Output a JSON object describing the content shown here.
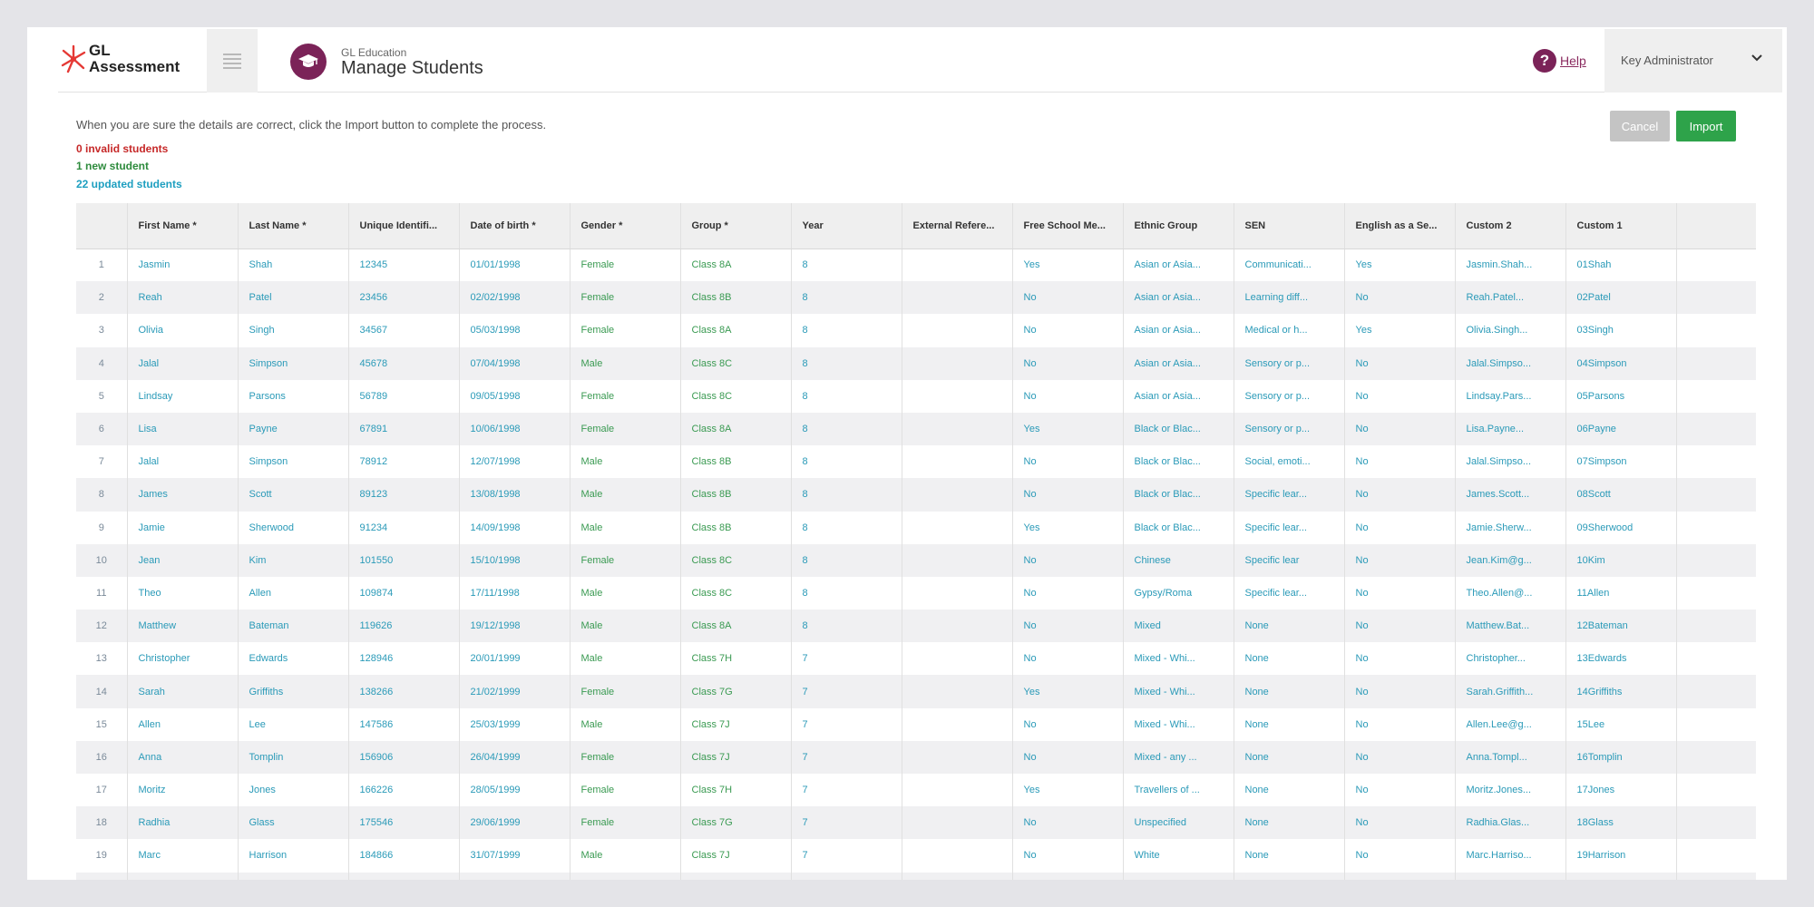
{
  "header": {
    "logo_text_line1": "GL",
    "logo_text_line2": "Assessment",
    "app_subtitle": "GL Education",
    "app_title": "Manage Students",
    "help_label": "Help",
    "user_name": "Key Administrator"
  },
  "instructions": "When you are sure the details are correct, click the Import button to complete the process.",
  "stats": {
    "invalid": "0 invalid students",
    "new": "1 new student",
    "updated": "22 updated students"
  },
  "buttons": {
    "cancel": "Cancel",
    "import": "Import"
  },
  "colors": {
    "brand": "#7b2358",
    "import_green": "#2ea34a",
    "invalid_red": "#c62828",
    "new_green": "#2e8b3d",
    "updated_blue": "#1e9fc0"
  },
  "table": {
    "columns": [
      "",
      "First Name *",
      "Last Name *",
      "Unique Identifi...",
      "Date of birth *",
      "Gender *",
      "Group *",
      "Year",
      "External Refere...",
      "Free School Me...",
      "Ethnic Group",
      "SEN",
      "English as a Se...",
      "Custom 2",
      "Custom 1",
      ""
    ],
    "rows": [
      [
        "1",
        "Jasmin",
        "Shah",
        "12345",
        "01/01/1998",
        "Female",
        "Class 8A",
        "8",
        "",
        "Yes",
        "Asian or Asia...",
        "Communicati...",
        "Yes",
        "Jasmin.Shah...",
        "01Shah"
      ],
      [
        "2",
        "Reah",
        "Patel",
        "23456",
        "02/02/1998",
        "Female",
        "Class 8B",
        "8",
        "",
        "No",
        "Asian or Asia...",
        "Learning diff...",
        "No",
        "Reah.Patel...",
        "02Patel"
      ],
      [
        "3",
        "Olivia",
        "Singh",
        "34567",
        "05/03/1998",
        "Female",
        "Class 8A",
        "8",
        "",
        "No",
        "Asian or Asia...",
        "Medical or h...",
        "Yes",
        "Olivia.Singh...",
        "03Singh"
      ],
      [
        "4",
        "Jalal",
        "Simpson",
        "45678",
        "07/04/1998",
        "Male",
        "Class 8C",
        "8",
        "",
        "No",
        "Asian or Asia...",
        "Sensory or p...",
        "No",
        "Jalal.Simpso...",
        "04Simpson"
      ],
      [
        "5",
        "Lindsay",
        "Parsons",
        "56789",
        "09/05/1998",
        "Female",
        "Class 8C",
        "8",
        "",
        "No",
        "Asian or Asia...",
        "Sensory or p...",
        "No",
        "Lindsay.Pars...",
        "05Parsons"
      ],
      [
        "6",
        "Lisa",
        "Payne",
        "67891",
        "10/06/1998",
        "Female",
        "Class 8A",
        "8",
        "",
        "Yes",
        "Black or Blac...",
        "Sensory or p...",
        "No",
        "Lisa.Payne...",
        "06Payne"
      ],
      [
        "7",
        "Jalal",
        "Simpson",
        "78912",
        "12/07/1998",
        "Male",
        "Class 8B",
        "8",
        "",
        "No",
        "Black or Blac...",
        "Social, emoti...",
        "No",
        "Jalal.Simpso...",
        "07Simpson"
      ],
      [
        "8",
        "James",
        "Scott",
        "89123",
        "13/08/1998",
        "Male",
        "Class 8B",
        "8",
        "",
        "No",
        "Black or Blac...",
        "Specific lear...",
        "No",
        "James.Scott...",
        "08Scott"
      ],
      [
        "9",
        "Jamie",
        "Sherwood",
        "91234",
        "14/09/1998",
        "Male",
        "Class 8B",
        "8",
        "",
        "Yes",
        "Black or Blac...",
        "Specific lear...",
        "No",
        "Jamie.Sherw...",
        "09Sherwood"
      ],
      [
        "10",
        "Jean",
        "Kim",
        "101550",
        "15/10/1998",
        "Female",
        "Class 8C",
        "8",
        "",
        "No",
        "Chinese",
        "Specific lear",
        "No",
        "Jean.Kim@g...",
        "10Kim"
      ],
      [
        "11",
        "Theo",
        "Allen",
        "109874",
        "17/11/1998",
        "Male",
        "Class 8C",
        "8",
        "",
        "No",
        "Gypsy/Roma",
        "Specific lear...",
        "No",
        "Theo.Allen@...",
        "11Allen"
      ],
      [
        "12",
        "Matthew",
        "Bateman",
        "119626",
        "19/12/1998",
        "Male",
        "Class 8A",
        "8",
        "",
        "No",
        "Mixed",
        "None",
        "No",
        "Matthew.Bat...",
        "12Bateman"
      ],
      [
        "13",
        "Christopher",
        "Edwards",
        "128946",
        "20/01/1999",
        "Male",
        "Class 7H",
        "7",
        "",
        "No",
        "Mixed - Whi...",
        "None",
        "No",
        "Christopher...",
        "13Edwards"
      ],
      [
        "14",
        "Sarah",
        "Griffiths",
        "138266",
        "21/02/1999",
        "Female",
        "Class 7G",
        "7",
        "",
        "Yes",
        "Mixed - Whi...",
        "None",
        "No",
        "Sarah.Griffith...",
        "14Griffiths"
      ],
      [
        "15",
        "Allen",
        "Lee",
        "147586",
        "25/03/1999",
        "Male",
        "Class 7J",
        "7",
        "",
        "No",
        "Mixed - Whi...",
        "None",
        "No",
        "Allen.Lee@g...",
        "15Lee"
      ],
      [
        "16",
        "Anna",
        "Tomplin",
        "156906",
        "26/04/1999",
        "Female",
        "Class 7J",
        "7",
        "",
        "No",
        "Mixed - any ...",
        "None",
        "No",
        "Anna.Tompl...",
        "16Tomplin"
      ],
      [
        "17",
        "Moritz",
        "Jones",
        "166226",
        "28/05/1999",
        "Female",
        "Class 7H",
        "7",
        "",
        "Yes",
        "Travellers of ...",
        "None",
        "No",
        "Moritz.Jones...",
        "17Jones"
      ],
      [
        "18",
        "Radhia",
        "Glass",
        "175546",
        "29/06/1999",
        "Female",
        "Class 7G",
        "7",
        "",
        "No",
        "Unspecified",
        "None",
        "No",
        "Radhia.Glas...",
        "18Glass"
      ],
      [
        "19",
        "Marc",
        "Harrison",
        "184866",
        "31/07/1999",
        "Male",
        "Class 7J",
        "7",
        "",
        "No",
        "White",
        "None",
        "No",
        "Marc.Harriso...",
        "19Harrison"
      ],
      [
        "",
        "",
        "",
        "",
        "",
        "",
        "",
        "",
        "",
        "",
        "",
        "",
        "",
        "",
        ""
      ]
    ]
  }
}
